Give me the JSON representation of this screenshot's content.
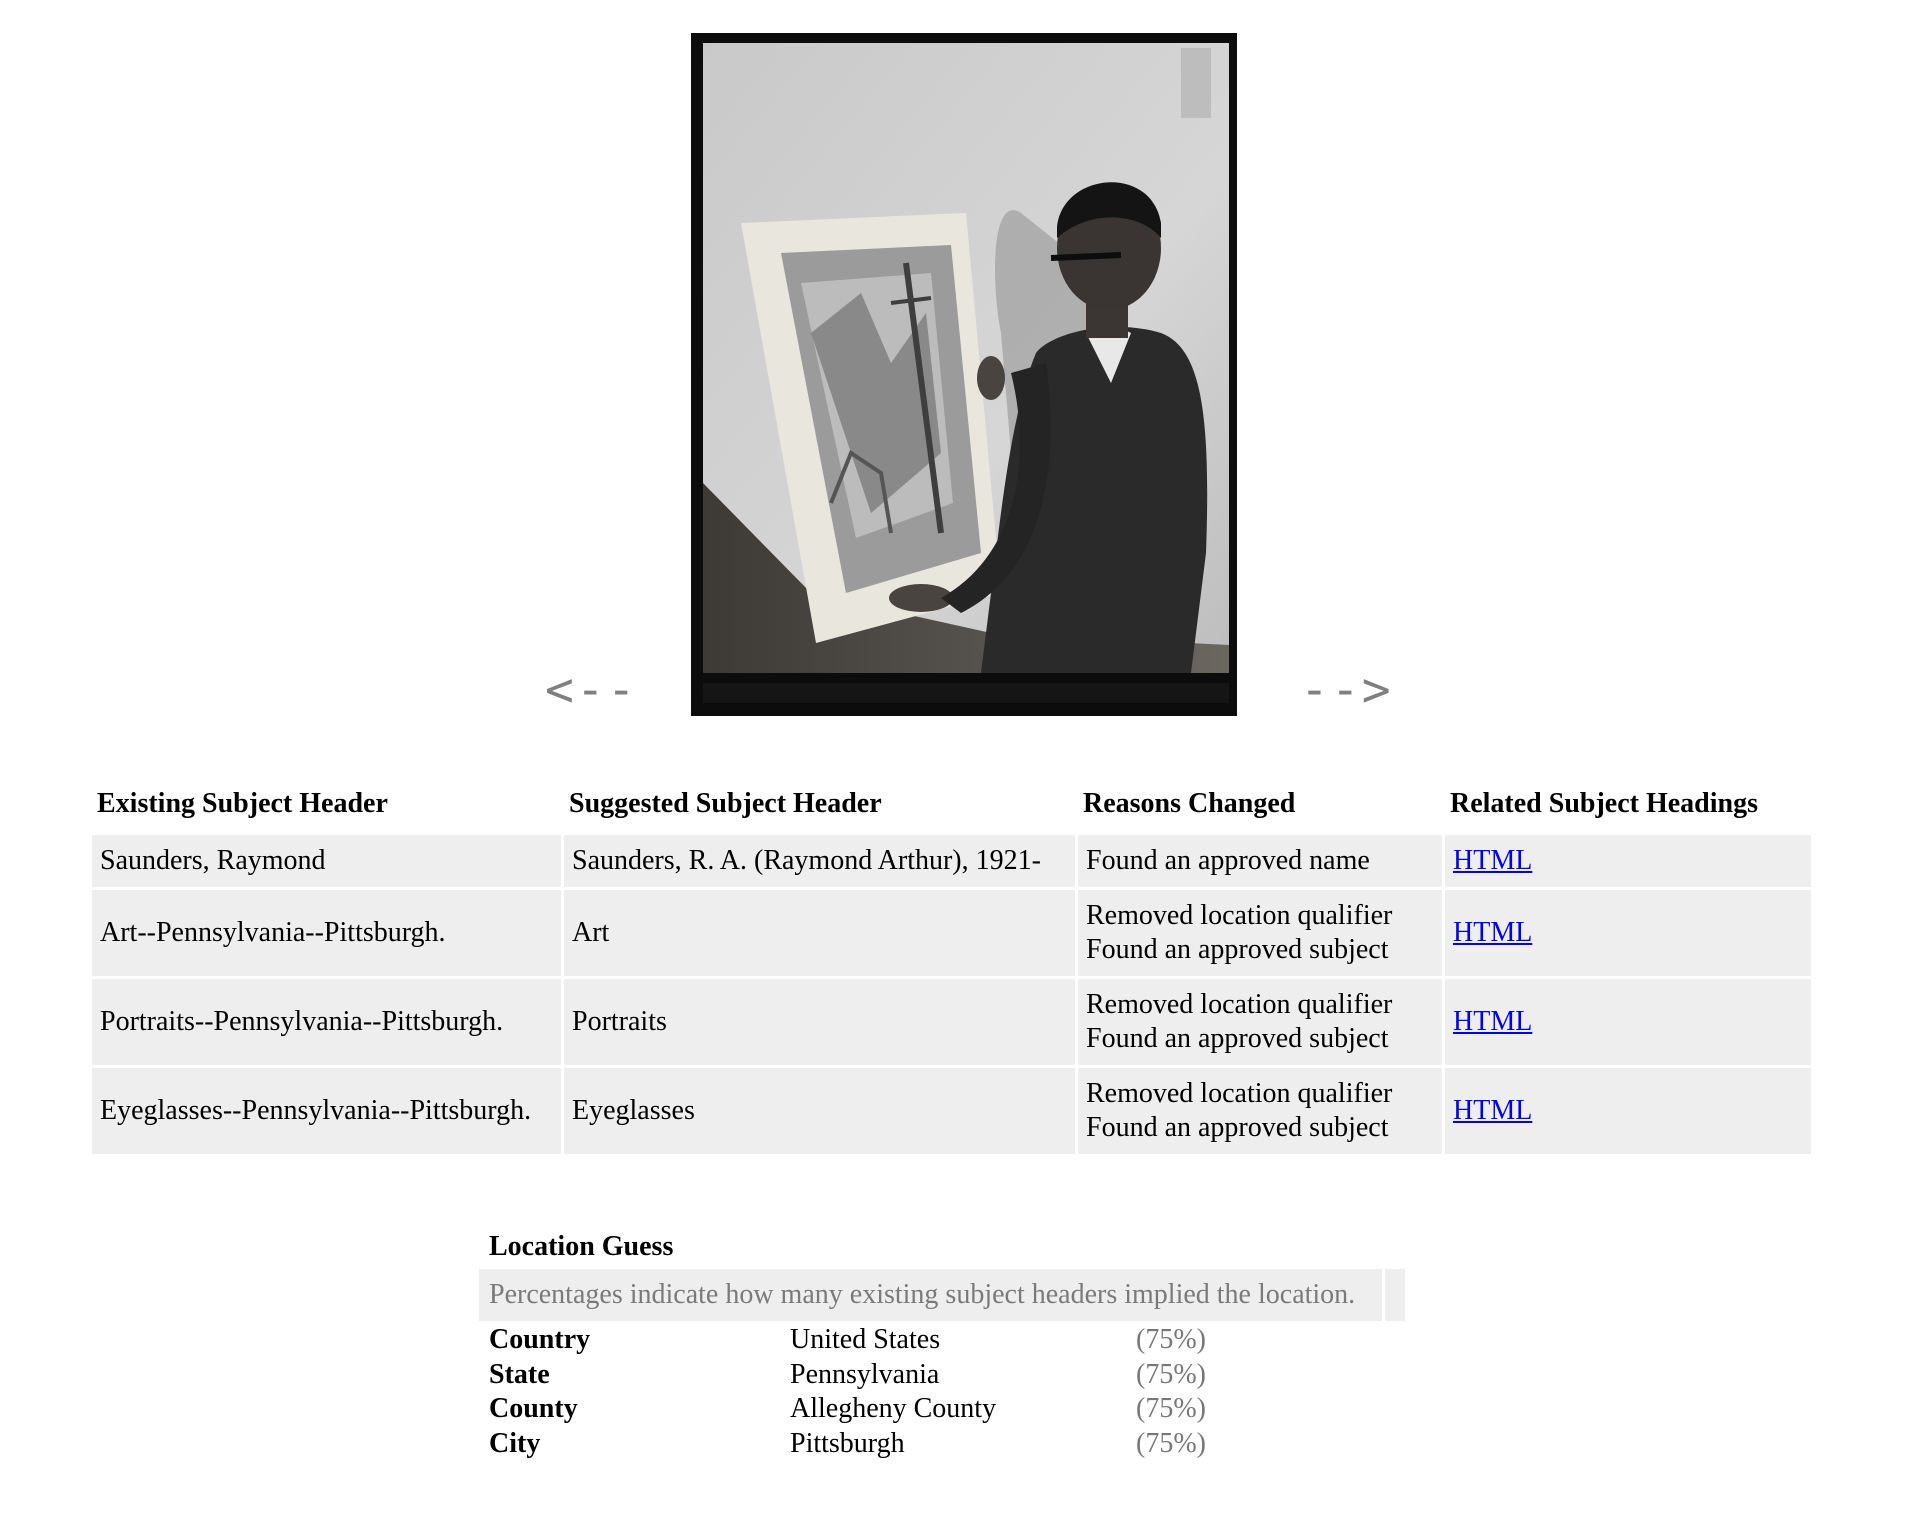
{
  "viewer": {
    "prev_label": "<--",
    "next_label": "-->",
    "photo_alt": "Photograph of a young man in eyeglasses holding a print of an artwork"
  },
  "subjects_table": {
    "headers": {
      "existing": "Existing Subject Header",
      "suggested": "Suggested Subject Header",
      "reasons": "Reasons Changed",
      "related": "Related Subject Headings"
    },
    "rows": [
      {
        "existing": "Saunders, Raymond",
        "suggested": "Saunders, R. A. (Raymond Arthur), 1921-",
        "reasons": [
          "Found an approved name"
        ],
        "related": "HTML"
      },
      {
        "existing": "Art--Pennsylvania--Pittsburgh.",
        "suggested": "Art",
        "reasons": [
          "Removed location qualifier",
          "Found an approved subject"
        ],
        "related": "HTML"
      },
      {
        "existing": "Portraits--Pennsylvania--Pittsburgh.",
        "suggested": "Portraits",
        "reasons": [
          "Removed location qualifier",
          "Found an approved subject"
        ],
        "related": "HTML"
      },
      {
        "existing": "Eyeglasses--Pennsylvania--Pittsburgh.",
        "suggested": "Eyeglasses",
        "reasons": [
          "Removed location qualifier",
          "Found an approved subject"
        ],
        "related": "HTML"
      }
    ]
  },
  "location_guess": {
    "title": "Location Guess",
    "note": "Percentages indicate how many existing subject headers implied the location.",
    "rows": [
      {
        "key": "Country",
        "value": "United States",
        "pct": "(75%)"
      },
      {
        "key": "State",
        "value": "Pennsylvania",
        "pct": "(75%)"
      },
      {
        "key": "County",
        "value": "Allegheny County",
        "pct": "(75%)"
      },
      {
        "key": "City",
        "value": "Pittsburgh",
        "pct": "(75%)"
      }
    ]
  },
  "colors": {
    "link": "#0000ee",
    "cell_bg": "#eeeeee",
    "arrow": "#808080",
    "muted_text": "#777777"
  }
}
